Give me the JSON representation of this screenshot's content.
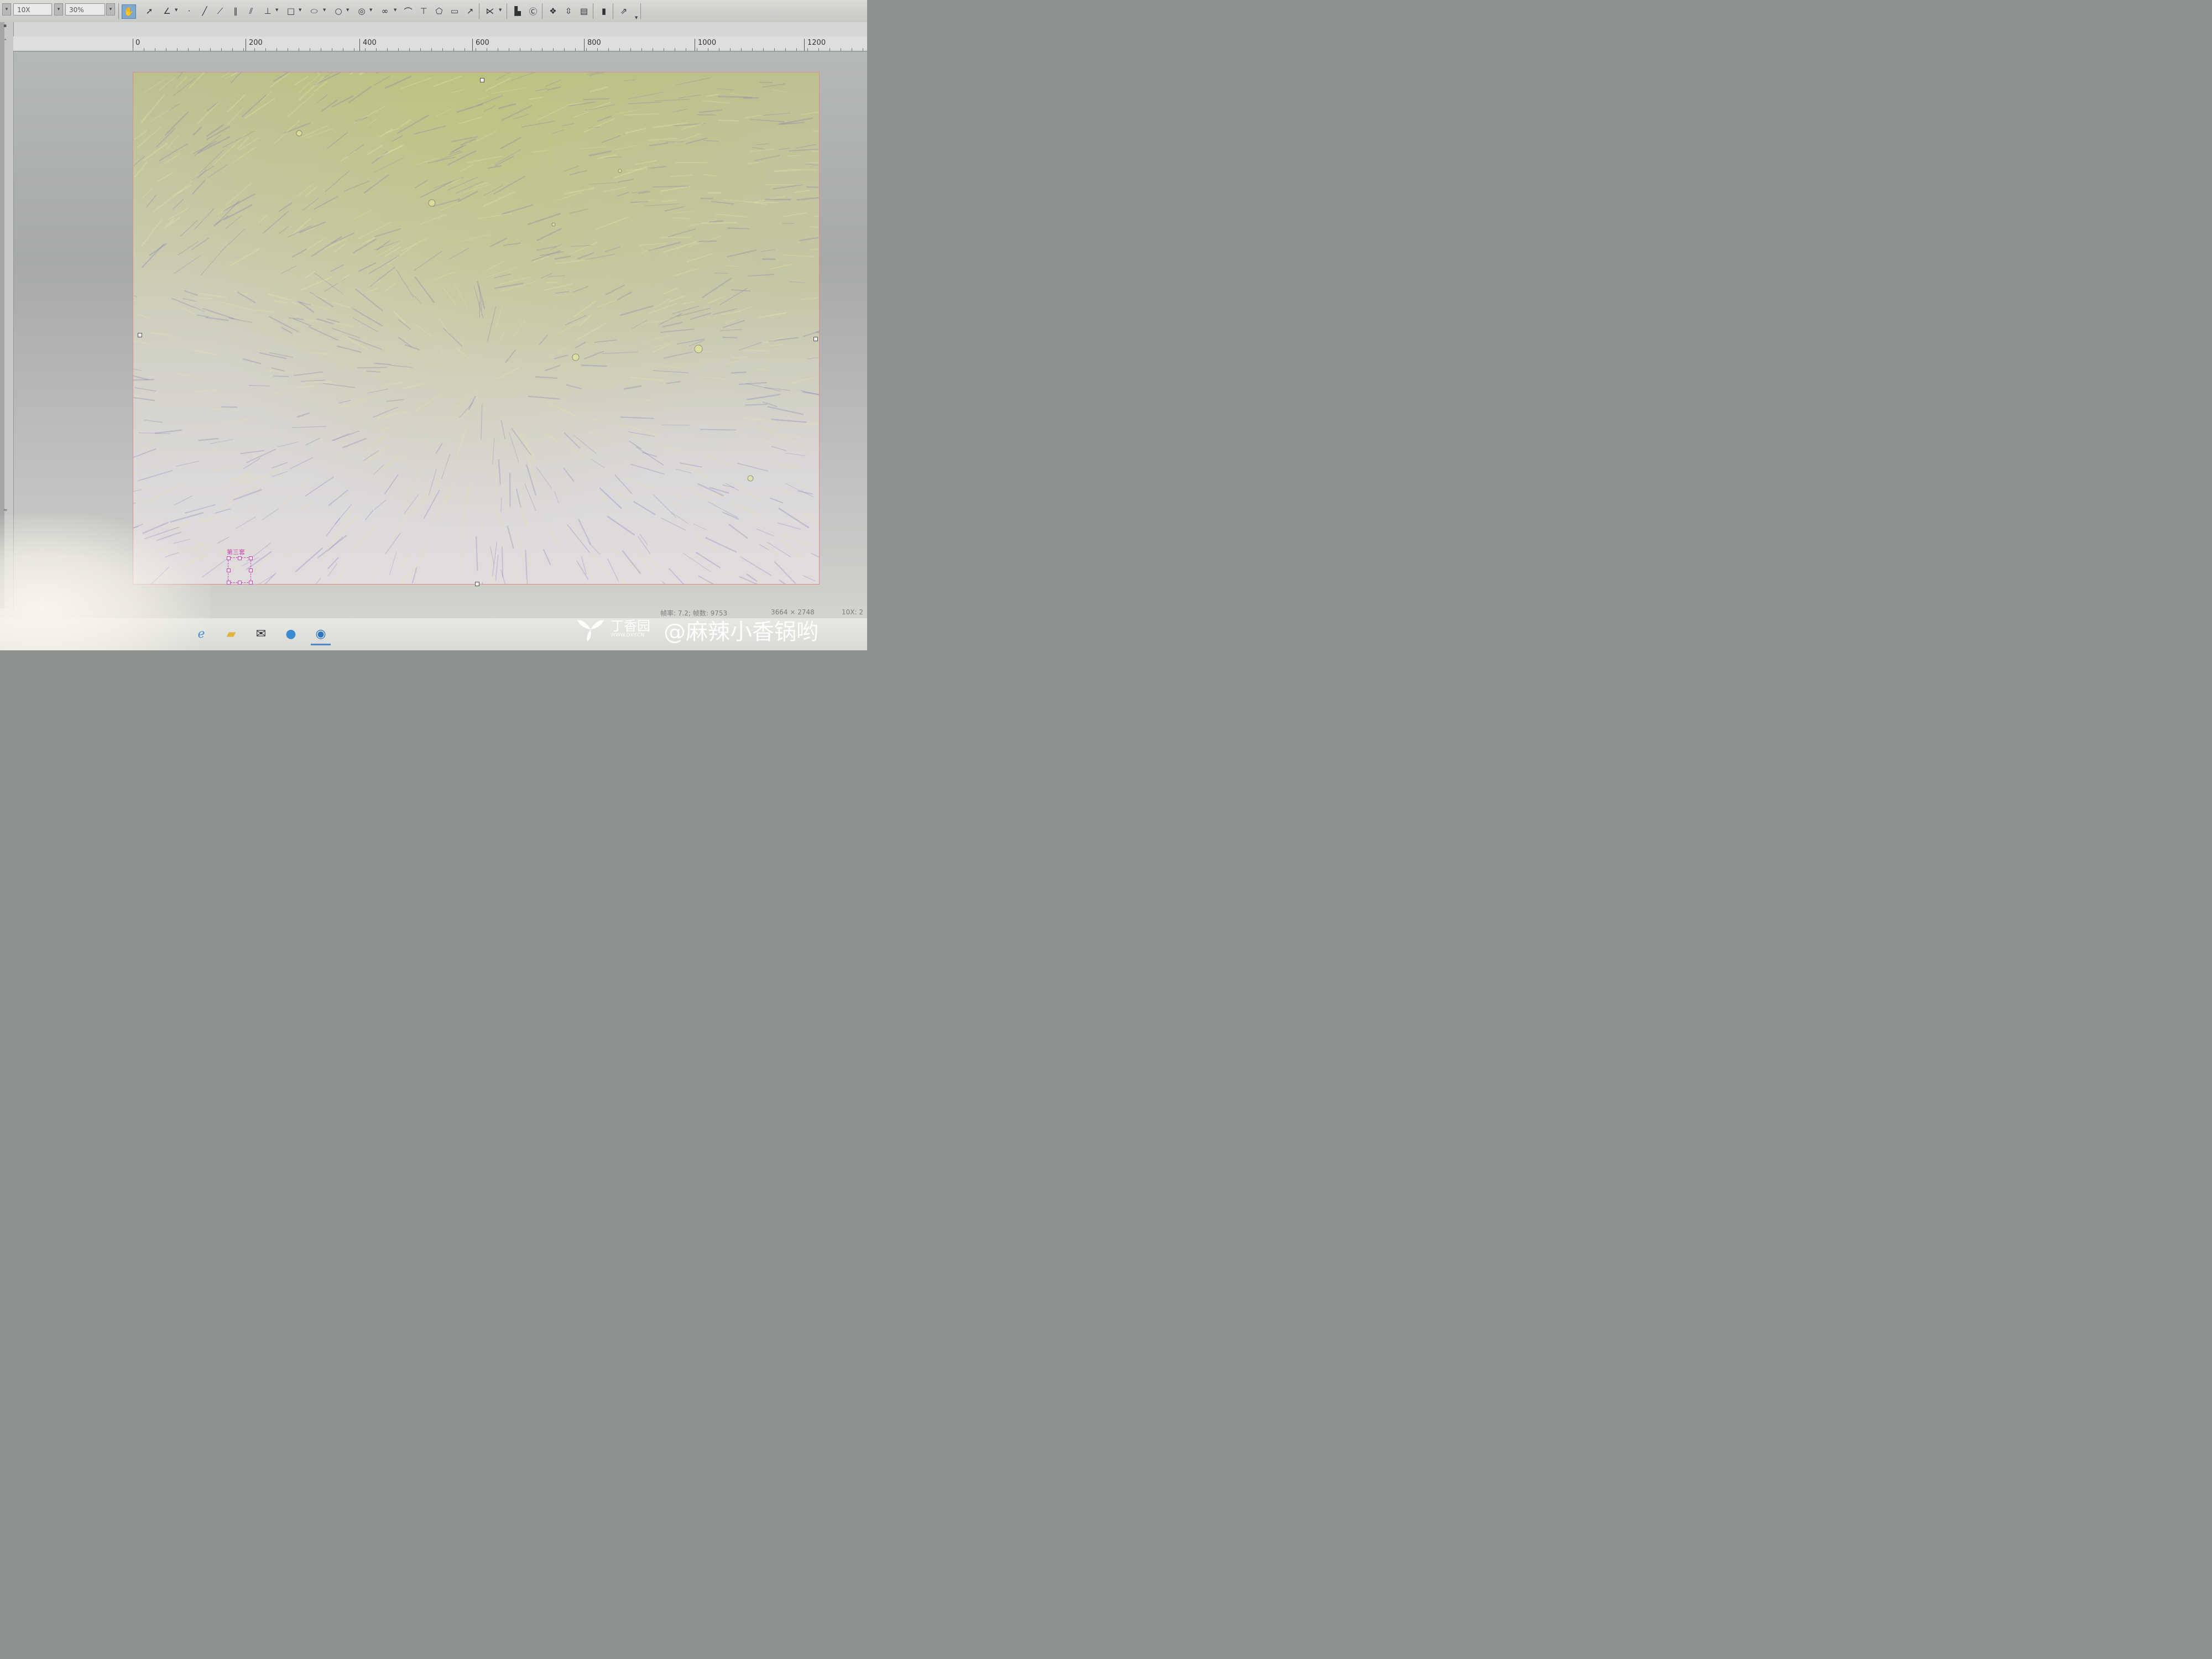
{
  "toolbar": {
    "objective_value": "10X",
    "zoom_value": "30%"
  },
  "ruler": {
    "labels": [
      "0",
      "200",
      "400",
      "600",
      "800",
      "1000",
      "1200"
    ]
  },
  "annotation": {
    "label": "第三套"
  },
  "status": {
    "frame_info": "帧率: 7.2; 帧数: 9753",
    "resolution": "3664 × 2748",
    "magnification": "10X: 2"
  },
  "watermark": {
    "site": "丁香园",
    "url": "WWW.DXY.CN",
    "user": "@麻辣小香锅哟"
  },
  "colors": {
    "canvas_border": "#d98e8e",
    "annotation": "#c545b0",
    "active_tool": "#7ea9cf"
  },
  "icons": {
    "taskbar": [
      "edge-browser-icon",
      "file-explorer-icon",
      "mail-icon",
      "camera-software-icon",
      "microscope-app-icon"
    ]
  }
}
